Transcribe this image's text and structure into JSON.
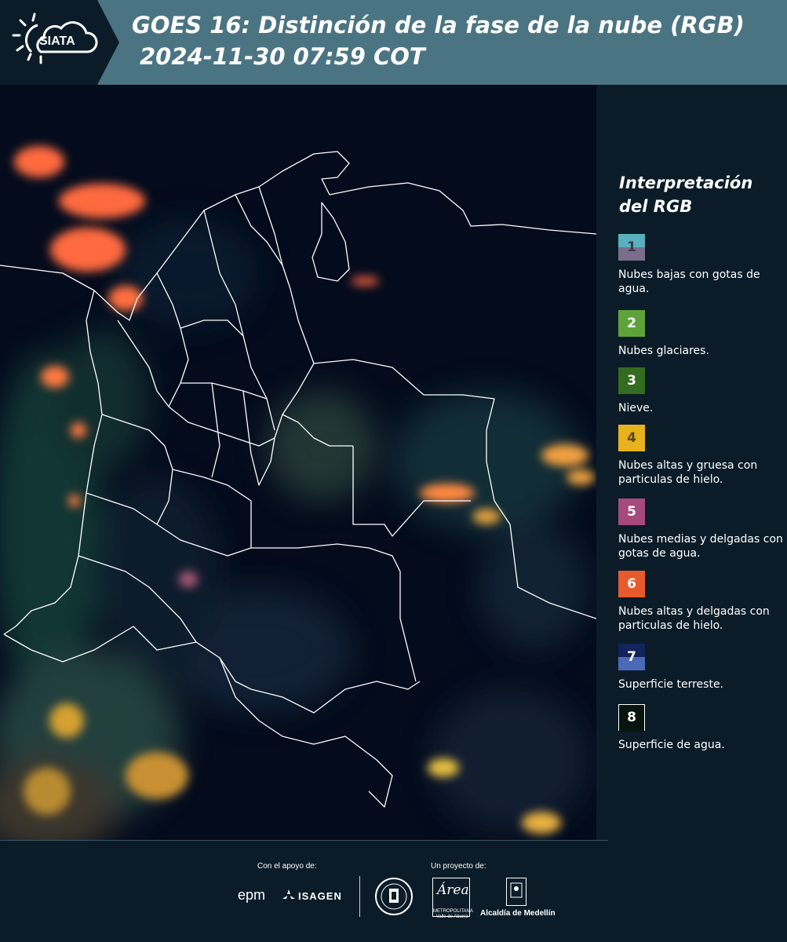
{
  "header": {
    "logo_text": "SIATA",
    "title": "GOES 16: Distinción de la fase de la nube (RGB)",
    "timestamp": "2024-11-30 07:59 COT",
    "background_color": "#4b7482"
  },
  "map": {
    "icon": "satellite-map",
    "background_color": "#030a18",
    "border_color": "#ffffff"
  },
  "legend": {
    "title": "Interpretación del RGB",
    "items": [
      {
        "number": "1",
        "label": "Nubes bajas con gotas de agua.",
        "top_color": "#5ab0bd",
        "bottom_color": "#7a6e8c",
        "number_color": "#3a3a4a"
      },
      {
        "number": "2",
        "label": "Nubes glaciares.",
        "top_color": "#5ea33a",
        "bottom_color": "#5ea33a",
        "number_color": "#ffffff"
      },
      {
        "number": "3",
        "label": "Nieve.",
        "top_color": "#336b1f",
        "bottom_color": "#336b1f",
        "number_color": "#ffffff"
      },
      {
        "number": "4",
        "label": "Nubes altas y gruesa con particulas de hielo.",
        "top_color": "#e8b21c",
        "bottom_color": "#e8b21c",
        "number_color": "#5a4a1a"
      },
      {
        "number": "5",
        "label": "Nubes medias y delgadas con gotas de agua.",
        "top_color": "#a64a7c",
        "bottom_color": "#a64a7c",
        "number_color": "#ffffff"
      },
      {
        "number": "6",
        "label": "Nubes altas y delgadas con particulas de hielo.",
        "top_color": "#e85a2c",
        "bottom_color": "#e85a2c",
        "number_color": "#ffffff"
      },
      {
        "number": "7",
        "label": "Superficie terreste.",
        "top_color": "#13235c",
        "bottom_color": "#4a6ab8",
        "number_color": "#ffffff"
      },
      {
        "number": "8",
        "label": "Superficie de agua.",
        "top_color": "#08140e",
        "bottom_color": "#08140e",
        "number_color": "#ffffff"
      }
    ]
  },
  "footer": {
    "support_label": "Con el apoyo de:",
    "project_label": "Un proyecto de:",
    "epm": "epm",
    "isagen": "ISAGEN",
    "area_script": "Área",
    "area_caption": "METROPOLITANA Valle de Aburrá",
    "alcaldia": "Alcaldía de Medellín"
  }
}
